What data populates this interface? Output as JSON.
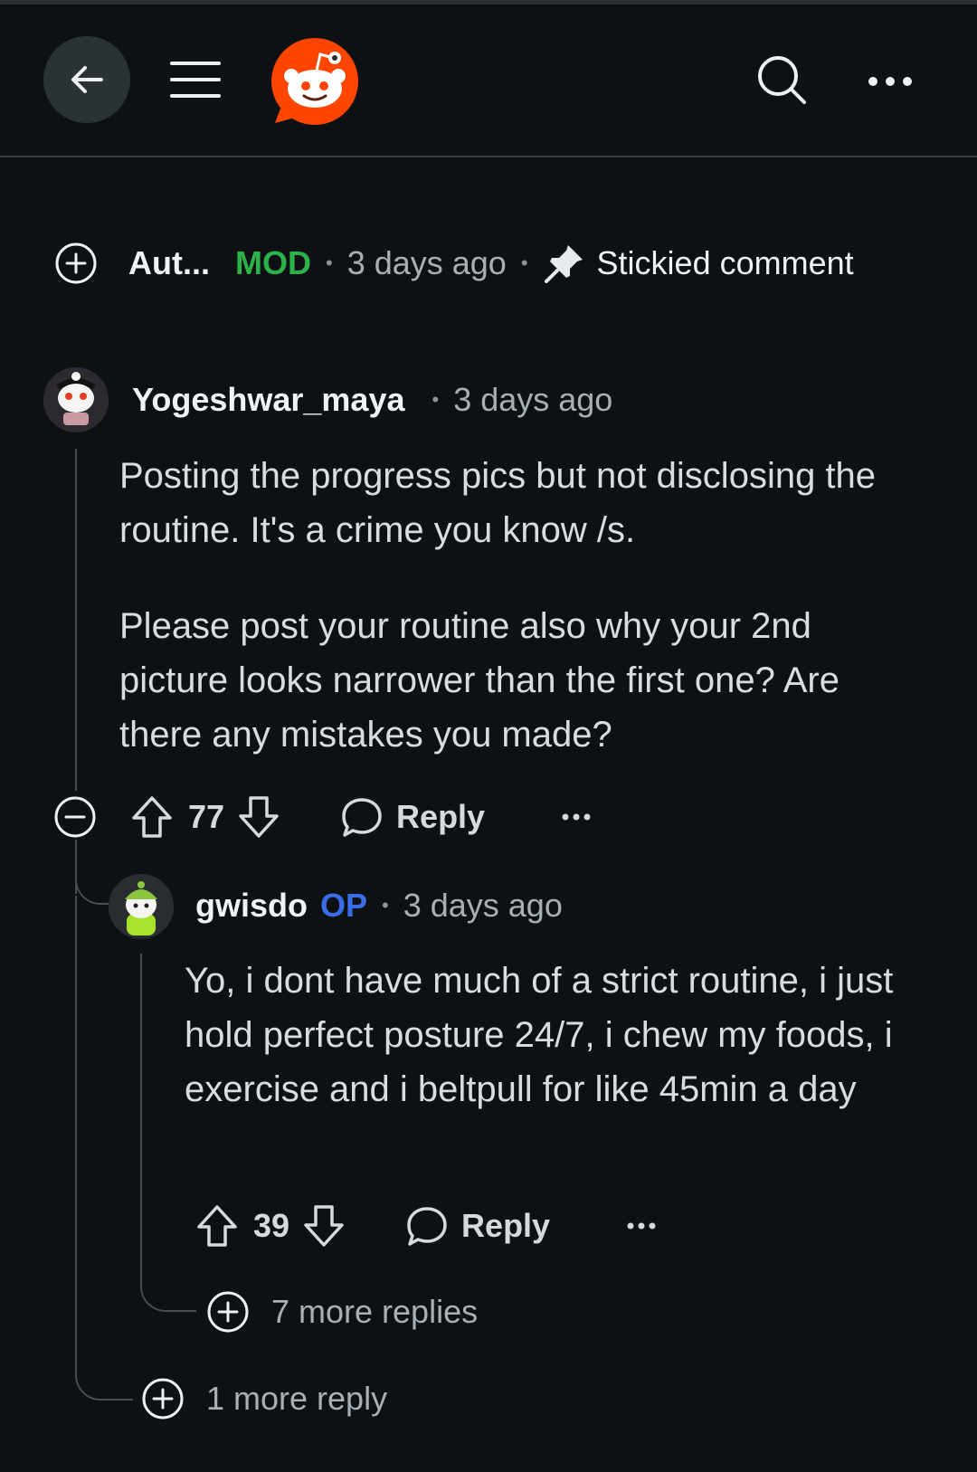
{
  "header": {
    "icons": [
      "back-arrow-icon",
      "hamburger-menu-icon",
      "reddit-logo",
      "search-icon",
      "more-options-icon"
    ]
  },
  "sticky": {
    "author": "Aut...",
    "badge": "MOD",
    "time": "3 days ago",
    "label": "Stickied comment",
    "icon": "pin-icon",
    "badge_color": "#2bb34a"
  },
  "comment1": {
    "author": "Yogeshwar_maya",
    "time": "3 days ago",
    "para1": "Posting the progress pics but not disclosing the routine. It's a crime you know /s.",
    "para2": "Please post your routine also why your 2nd picture looks narrower than the first one? Are there any mistakes you made?",
    "votes": "77",
    "reply_label": "Reply"
  },
  "comment2": {
    "author": "gwisdo",
    "badge": "OP",
    "badge_color": "#3a6ee8",
    "time": "3 days ago",
    "body": "Yo, i dont have much of a strict routine, i just hold perfect posture 24/7, i chew my foods, i exercise and i beltpull for like 45min a day",
    "votes": "39",
    "reply_label": "Reply",
    "more_replies": "7 more replies"
  },
  "more_reply": "1 more reply",
  "separator": "•"
}
